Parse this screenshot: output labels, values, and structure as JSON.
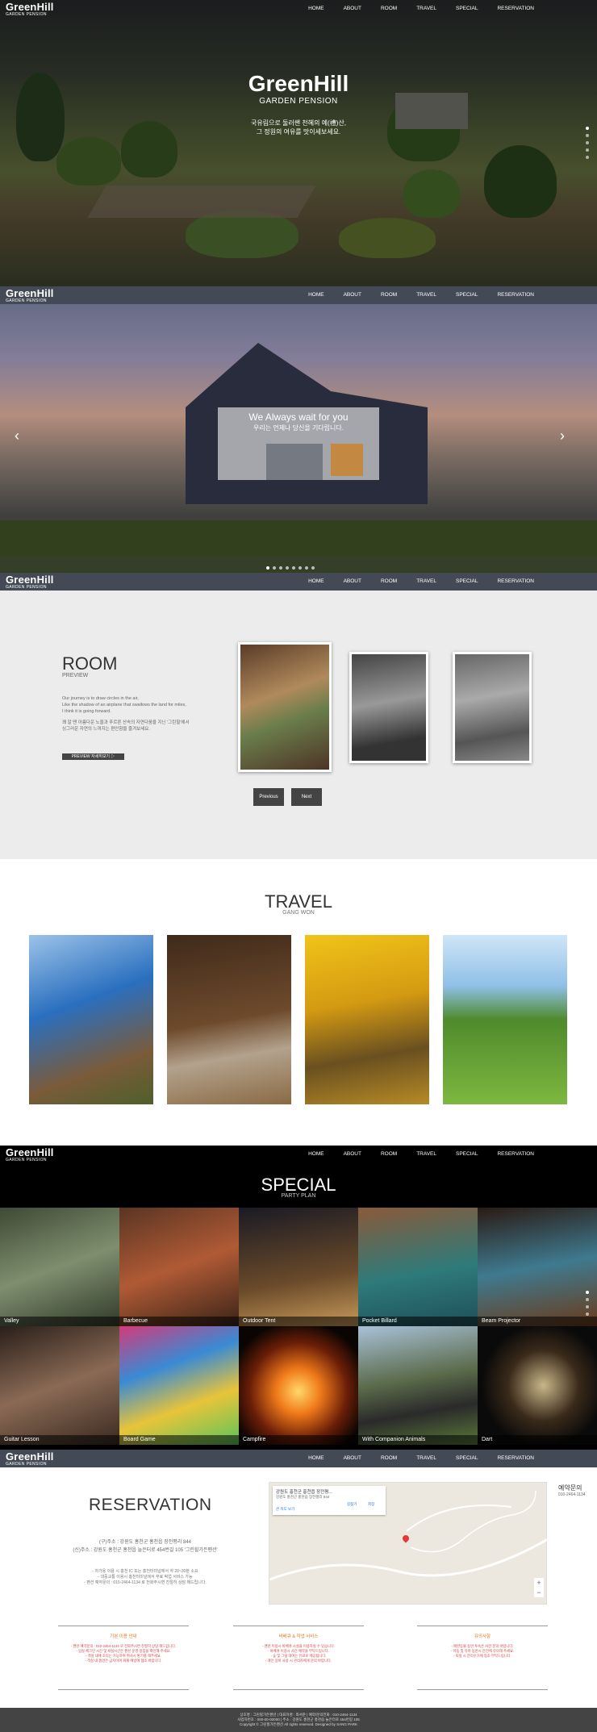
{
  "nav": {
    "logo_title": "GreenHill",
    "logo_sub": "GARDEN PENSION",
    "items": [
      "HOME",
      "ABOUT",
      "ROOM",
      "TRAVEL",
      "SPECIAL",
      "RESERVATION"
    ]
  },
  "hero": {
    "title": "GreenHill",
    "subtitle": "GARDEN PENSION",
    "line1": "국유림으로 둘러쌘 천혜의 예(禮)산,",
    "line2": "그 정원의 여유를 맛이세보세요."
  },
  "about": {
    "line1": "We Always wait for you",
    "line2": "우리는 언제나 당신을 기다립니다."
  },
  "room": {
    "title": "ROOM",
    "sub": "PREVIEW",
    "desc1": "Our journey is to draw circles in the air,",
    "desc2": "Like the shadow of an airplane that swallows the land for miles,",
    "desc3": "I think it is going forward.",
    "desc4": "꽤 알 땐 아름다운 노을과 푸르른 산속의 자연다움을 지닌 '그린힐'에서",
    "desc5": "싱그러운 자연의 느껴지는 편안함을 즐겨보세요.",
    "preview_button": "PREVIEW 자세히보기 ▷",
    "previous": "Previous",
    "next": "Next"
  },
  "travel": {
    "title": "TRAVEL",
    "sub": "GANG WON"
  },
  "special": {
    "title": "SPECIAL",
    "sub": "PARTY PLAN",
    "tiles": [
      "Valley",
      "Barbecue",
      "Outdoor Tent",
      "Pocket Billard",
      "Beam Projector",
      "Guitar Lesson",
      "Board Game",
      "Campfire",
      "With Companion Animals",
      "Dart"
    ]
  },
  "reservation": {
    "title": "RESERVATION",
    "addr1": "(구)주소 : 강원도 홍천군 홍천읍 장전평리 844",
    "addr2": "(신)주소 : 강원도 홍천군 홍천읍 늘은터로 454번길 105 '그린힐가든펜션'",
    "note1": "- 차가용 이용 시 홍천 IC 또는 홍천터미널에서 약 20~30분 소요",
    "note2": "- 대중교통 이용시 홍천터미널에서 무료 픽업 서비스 가능",
    "note3": "- 펜션 예약문의 : 010-2464-1134 로 전화주시면 친절히 상담 해드립니다.",
    "map_place": "강원도 홍천군 홍천읍 장전평...",
    "map_addr": "강원도 홍천군 홍천읍 장전평리 844",
    "map_link": "큰 지도 보기",
    "map_dir": "길찾기",
    "map_save": "저장",
    "inquiry_title": "예약문의",
    "inquiry_phone": "010-2464-1134"
  },
  "info": [
    {
      "title": "기본 이용 안내",
      "lines": [
        "- 펜션 예약문의 : 010-2464-1134 로 전화주시면 친절히 상담 해드립니다.",
        "- 입실 체크인 시간 및 퇴실시간은 펜션 운영 방침을 확인해 주세요.",
        "- 객실 내에 조리는 가능하며 취사시 환기를 해주세요.",
        "- 객실 내 흡연은 금지이며 화재 예방에 협조 바랍니다."
      ]
    },
    {
      "title": "바베큐 & 작업 서비스",
      "lines": [
        "- 펜션 이용시 바베큐 시설을 이용하실 수 있습니다.",
        "- 바베큐 이용시 사전 예약을 부탁드립니다.",
        "- 숯 및 그릴 대여는 유료로 제공됩니다.",
        "- 개인 장비 사용 시 관리자에게 문의 바랍니다."
      ]
    },
    {
      "title": "유의사항",
      "lines": [
        "- 애완동물 동반 투숙은 사전 문의 바랍니다.",
        "- 아동 및 유아 동반시 안전에 유의해 주세요.",
        "- 퇴실 시 분리수거에 협조 부탁드립니다."
      ]
    }
  ],
  "footer": {
    "line1": "상호명 : 그린힐가든펜션 | 대표자명 : 최서준 | 예약/문의전화 : 010-2464-1134",
    "line2": "사업자번호 : 000-00-00000 | 주소 : 강원도 홍천군 홍천읍 늘은터로 454번길 105",
    "line3": "Copyright © 그린힐가든펜션 All rights reserved. Designed by SANG PARK"
  },
  "colors": {
    "nav_dark": "#444a55",
    "accent": "#e87722",
    "room_bg": "#ececec"
  }
}
